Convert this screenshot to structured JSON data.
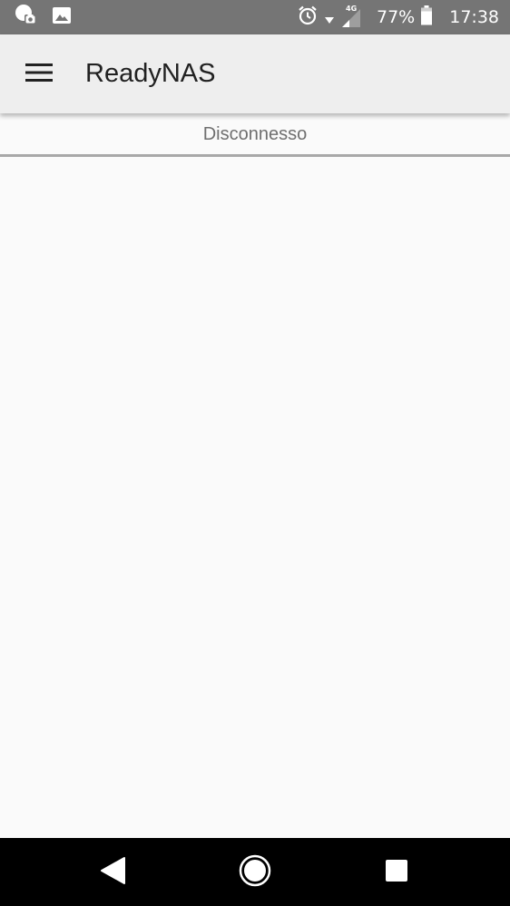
{
  "status_bar": {
    "left_icons": [
      "camera-notification-icon",
      "image-notification-icon"
    ],
    "right_icons": [
      "alarm-icon",
      "wifi-icon",
      "signal-icon",
      "battery-icon"
    ],
    "network_type": "4G",
    "battery_percent": "77%",
    "battery_level": 0.77,
    "time": "17:38"
  },
  "app_bar": {
    "menu_icon": "hamburger-menu-icon",
    "title": "ReadyNAS",
    "background": "#eeeeee"
  },
  "connection": {
    "status_text": "Disconnesso"
  },
  "nav_bar": {
    "buttons": [
      "back-icon",
      "home-icon",
      "recents-icon"
    ],
    "background": "#000000"
  },
  "colors": {
    "status_bar": "#757575",
    "page_background": "#fafafa",
    "status_text": "#6f6f6f"
  }
}
